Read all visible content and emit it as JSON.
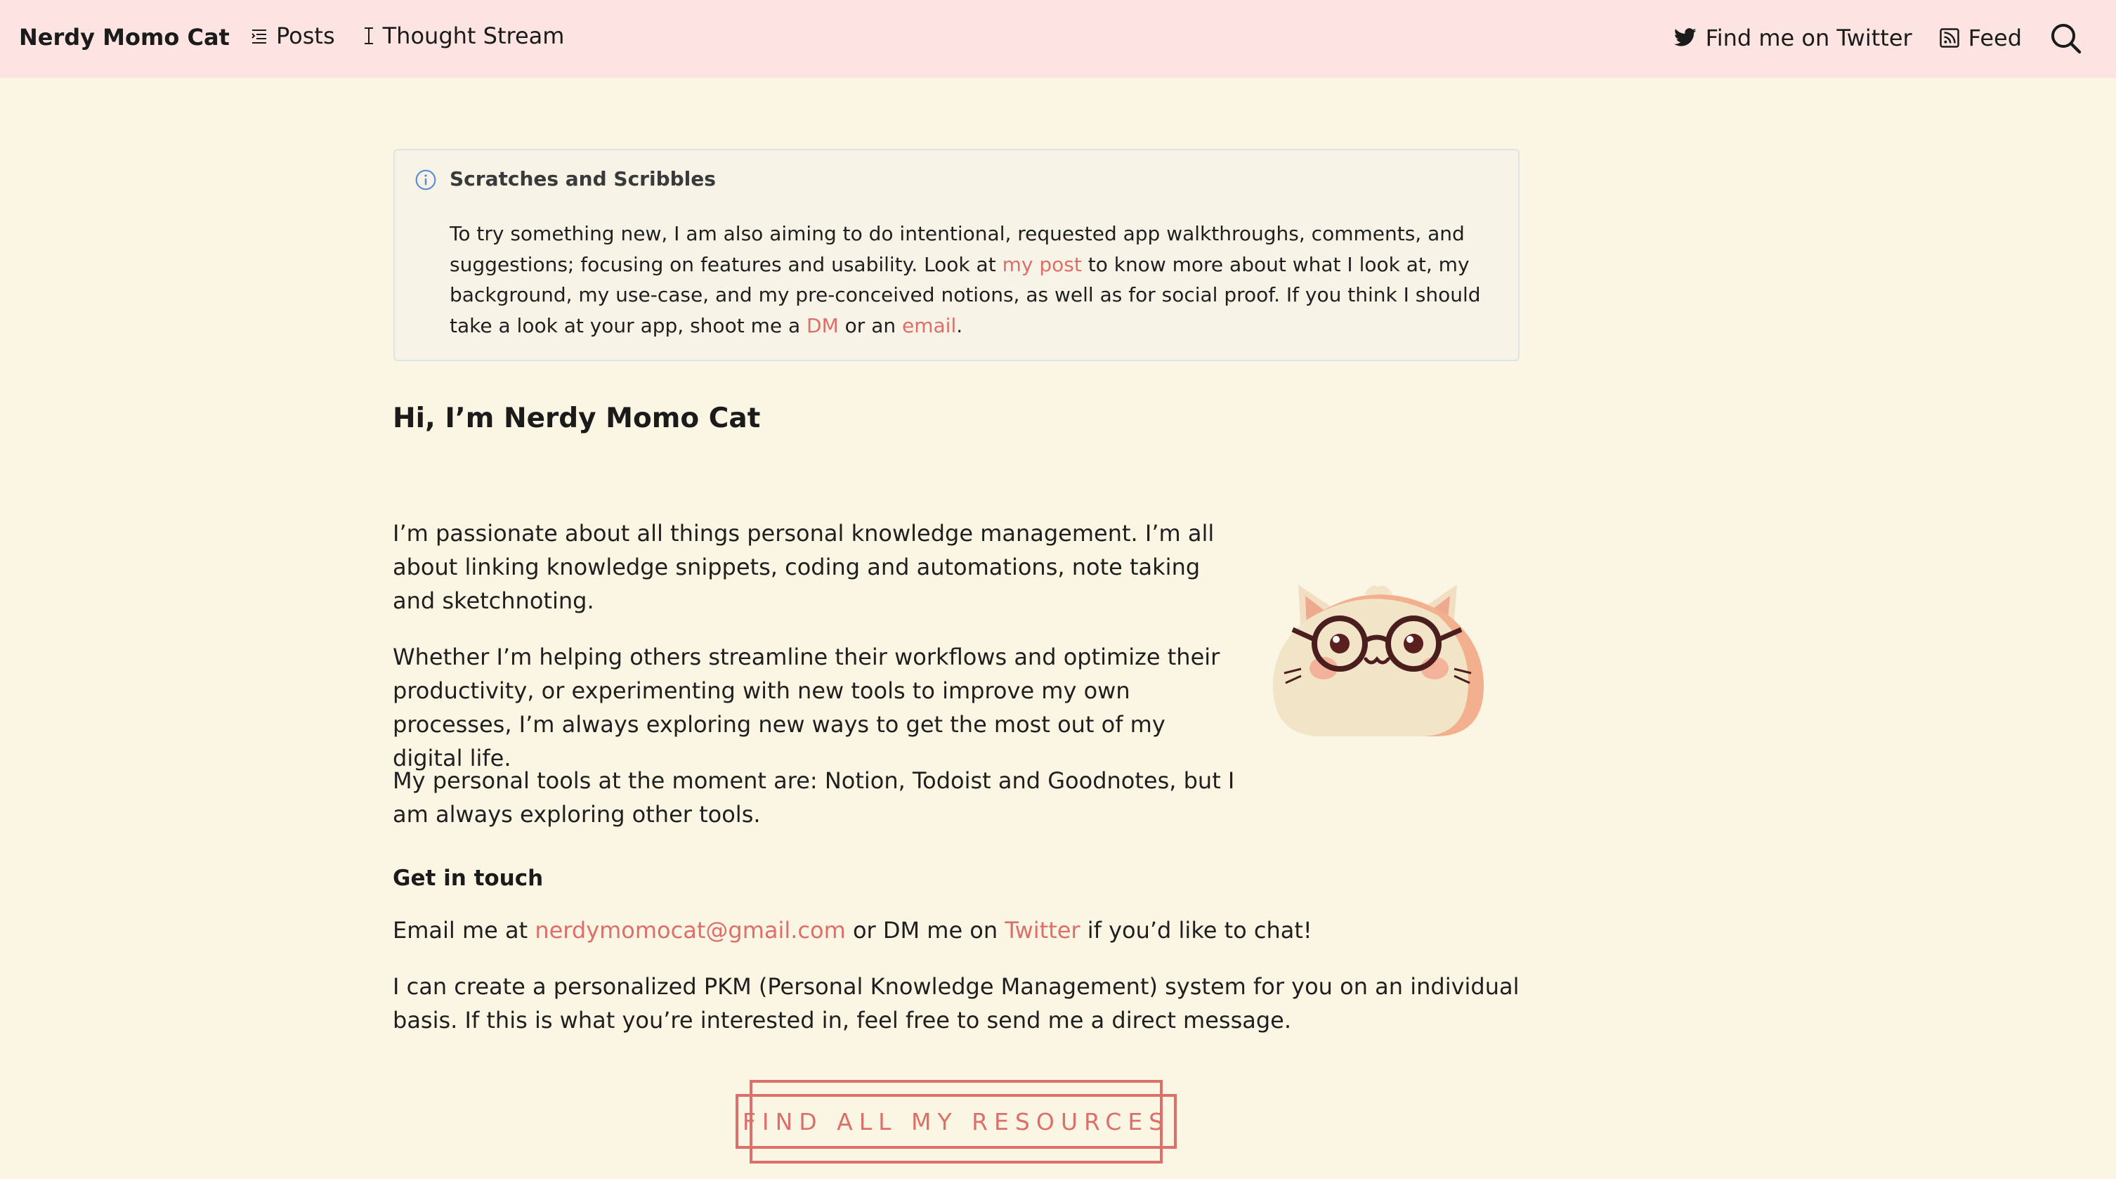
{
  "header": {
    "brand": "Nerdy Momo Cat",
    "nav_left": [
      {
        "label": "Posts",
        "icon": "list-icon"
      },
      {
        "label": "Thought Stream",
        "icon": "text-cursor-icon"
      }
    ],
    "nav_right": [
      {
        "label": "Find me on Twitter",
        "icon": "twitter-bird-icon"
      },
      {
        "label": "Feed",
        "icon": "rss-icon"
      }
    ],
    "search_icon": "search-icon"
  },
  "callout": {
    "icon": "info-icon",
    "title": "Scratches and Scribbles",
    "body_1": "To try something new, I am also aiming to do intentional, requested app walkthroughs, comments, and suggestions; focusing on features and usability. Look at ",
    "link_post": "my post",
    "body_2": " to know more about what I look at, my background, my use-case, and my pre-conceived notions, as well as for social proof. If you think I should take a look at your app, shoot me a ",
    "link_dm": "DM",
    "body_3": " or an ",
    "link_email": "email",
    "body_4": "."
  },
  "intro": {
    "heading": "Hi, I’m Nerdy Momo Cat",
    "para1": "I’m passionate about all things personal knowledge management. I’m all about linking knowledge snippets, coding and automations, note taking and sketchnoting.",
    "para2": "Whether I’m helping others streamline their workflows and optimize their productivity, or experimenting with new tools to improve my own processes, I’m always exploring new ways to get the most out of my digital life.",
    "para3": "My personal tools at the moment are: Notion, Todoist and Goodnotes, but I am always exploring other tools.",
    "avatar_icon": "cat-with-glasses-icon"
  },
  "contact": {
    "heading": "Get in touch",
    "email_prefix": "Email me at ",
    "email": "nerdymomocat@gmail.com",
    "email_mid": " or DM me on ",
    "twitter_link": "Twitter",
    "email_suffix": " if you’d like to chat!",
    "pkm_text": "I can create a personalized PKM (Personal Knowledge Management) system for you on an individual basis. If this is what you’re interested in, feel free to send me a direct message."
  },
  "cta": {
    "label": "FIND ALL MY RESOURCES"
  },
  "colors": {
    "nav_bg": "#fbe4e2",
    "page_bg": "#fbf6e4",
    "accent": "#dc6f69",
    "info_icon": "#5b8ad6"
  }
}
